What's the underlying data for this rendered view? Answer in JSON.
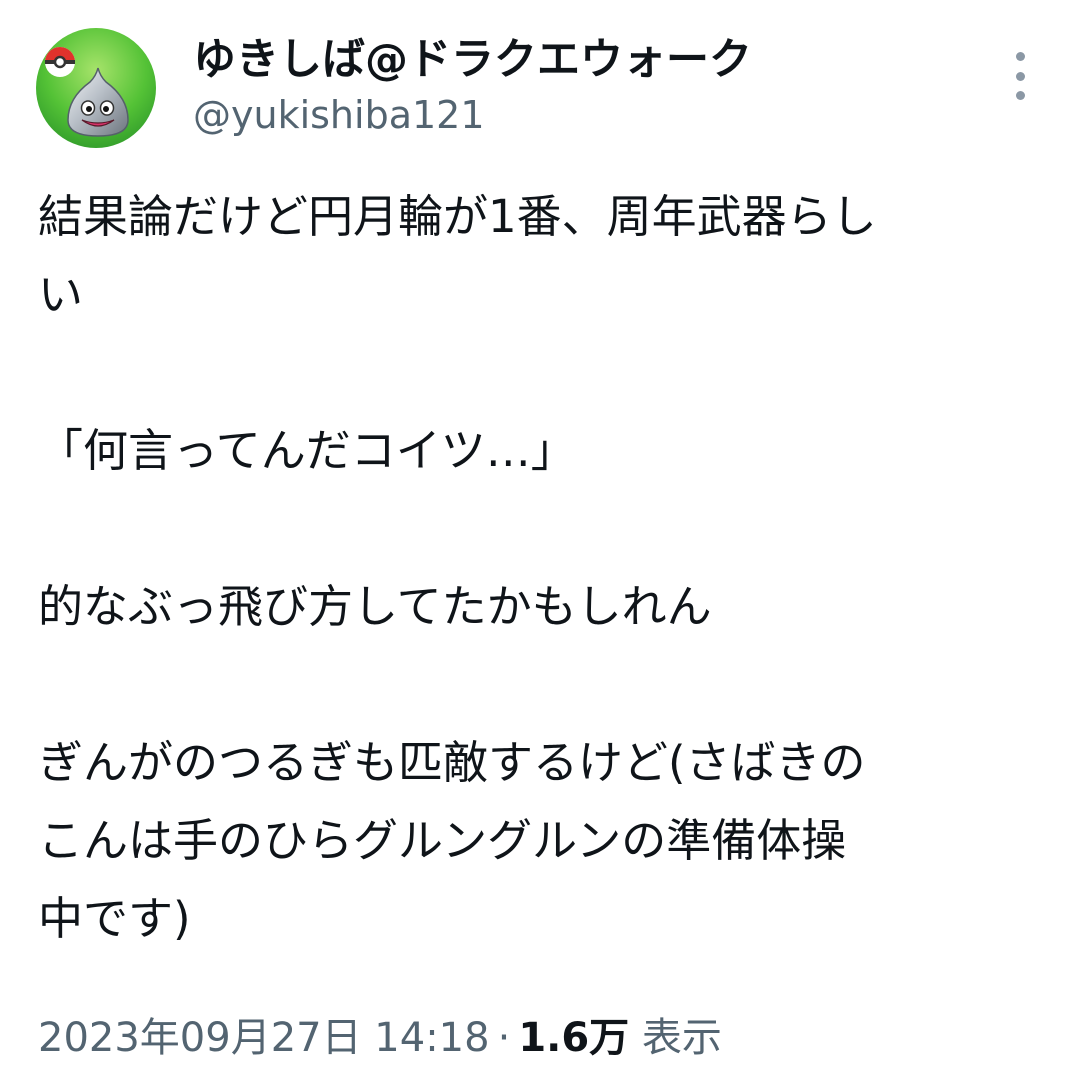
{
  "user": {
    "display_name": "ゆきしば@ドラクエウォーク",
    "handle": "@yukishiba121"
  },
  "avatar_icon": "metal-slime-avatar",
  "tweet": {
    "lines": [
      "結果論だけど円月輪が1番、周年武器らし",
      "い",
      "",
      "「何言ってんだコイツ…」",
      "",
      "的なぶっ飛び方してたかもしれん",
      "",
      "ぎんがのつるぎも匹敵するけど(さばきの",
      "こんは手のひらグルングルンの準備体操",
      "中です)"
    ]
  },
  "meta": {
    "timestamp": "2023年09月27日 14:18",
    "separator": "·",
    "views_count": "1.6万",
    "views_label": "表示"
  },
  "colors": {
    "primary_text": "#0f1419",
    "secondary_text": "#536471",
    "more_dots": "#8b98a5"
  }
}
